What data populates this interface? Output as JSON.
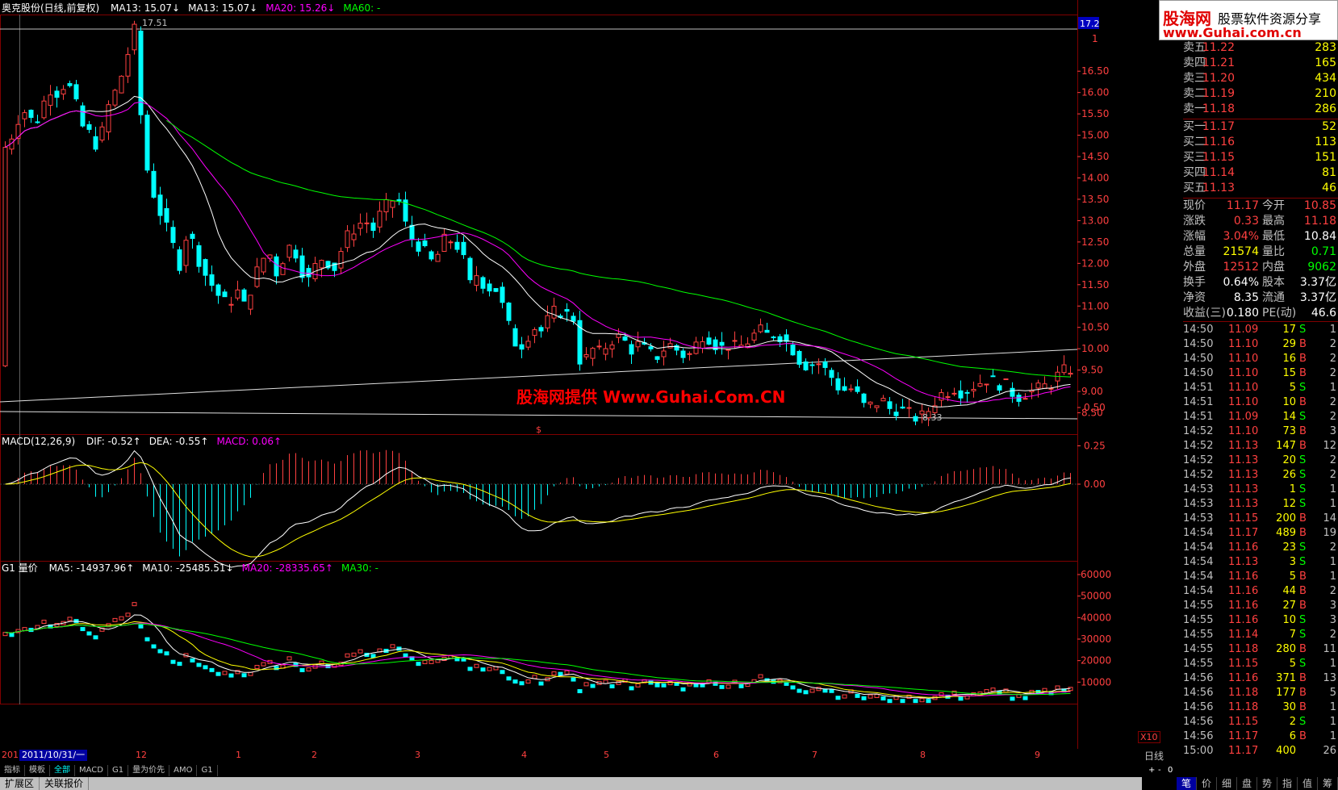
{
  "header": {
    "main": {
      "title": "奥克股份(日线,前复权)",
      "ma_items": [
        {
          "label": "MA13: 15.07",
          "arrow": "↓",
          "color": "#ffffff"
        },
        {
          "label": "MA13: 15.07",
          "arrow": "↓",
          "color": "#ffffff"
        },
        {
          "label": "MA20: 15.26",
          "arrow": "↓",
          "color": "#ff00ff"
        },
        {
          "label": "MA60: -",
          "arrow": "",
          "color": "#00ff00"
        }
      ]
    },
    "macd": {
      "title": "MACD(12,26,9)",
      "items": [
        {
          "label": "DIF: -0.52",
          "arrow": "↑",
          "color": "#ffffff"
        },
        {
          "label": "DEA: -0.55",
          "arrow": "↑",
          "color": "#ffffff"
        },
        {
          "label": "MACD: 0.06",
          "arrow": "↑",
          "color": "#ff00ff"
        }
      ]
    },
    "vol": {
      "title": "G1 量价",
      "items": [
        {
          "label": "MA5: -14937.96",
          "arrow": "↑",
          "color": "#ffffff"
        },
        {
          "label": "MA10: -25485.51",
          "arrow": "↓",
          "color": "#ffffff"
        },
        {
          "label": "MA20: -28335.65",
          "arrow": "↑",
          "color": "#ff00ff"
        },
        {
          "label": "MA30: -",
          "arrow": "",
          "color": "#00ff00"
        }
      ]
    }
  },
  "price_axis": {
    "current_tag": "17.2",
    "ticks": [
      "16.50",
      "16.00",
      "15.50",
      "15.00",
      "14.50",
      "14.00",
      "13.50",
      "13.00",
      "12.50",
      "12.00",
      "11.50",
      "11.00",
      "10.50",
      "10.00",
      "9.50",
      "9.00",
      "8.50"
    ],
    "top_label": "1"
  },
  "macd_axis": {
    "ticks": [
      "0.50",
      "0.25",
      "0.00"
    ]
  },
  "vol_axis": {
    "ticks": [
      "60000",
      "50000",
      "40000",
      "30000",
      "20000",
      "10000"
    ],
    "scale_label": "X10"
  },
  "annotations": {
    "high_label": "17.51",
    "low_label": "8.33",
    "marker": "$",
    "watermark": "股海网提供 Www.Guhai.Com.CN"
  },
  "x_axis": {
    "date_box": "2011/10/31/一",
    "left_stub": "201",
    "labels": [
      "12",
      "1",
      "2",
      "3",
      "4",
      "5",
      "6",
      "7",
      "8",
      "9"
    ],
    "period": "日线"
  },
  "banner": {
    "site": "股海网",
    "slogan": "股票软件资源分享",
    "url": "www.Guhai.com.cn"
  },
  "orderbook": {
    "asks": [
      {
        "label": "卖五",
        "price": "11.22",
        "vol": "283"
      },
      {
        "label": "卖四",
        "price": "11.21",
        "vol": "165"
      },
      {
        "label": "卖三",
        "price": "11.20",
        "vol": "434"
      },
      {
        "label": "卖二",
        "price": "11.19",
        "vol": "210"
      },
      {
        "label": "卖一",
        "price": "11.18",
        "vol": "286"
      }
    ],
    "bids": [
      {
        "label": "买一",
        "price": "11.17",
        "vol": "52"
      },
      {
        "label": "买二",
        "price": "11.16",
        "vol": "113"
      },
      {
        "label": "买三",
        "price": "11.15",
        "vol": "151"
      },
      {
        "label": "买四",
        "price": "11.14",
        "vol": "81"
      },
      {
        "label": "买五",
        "price": "11.13",
        "vol": "46"
      }
    ]
  },
  "quote": [
    {
      "l1": "现价",
      "v1": "11.17",
      "c1": "#ff4040",
      "l2": "今开",
      "v2": "10.85",
      "c2": "#ff4040"
    },
    {
      "l1": "涨跌",
      "v1": "0.33",
      "c1": "#ff4040",
      "l2": "最高",
      "v2": "11.18",
      "c2": "#ff4040"
    },
    {
      "l1": "涨幅",
      "v1": "3.04%",
      "c1": "#ff4040",
      "l2": "最低",
      "v2": "10.84",
      "c2": "#ffffff"
    },
    {
      "l1": "总量",
      "v1": "21574",
      "c1": "#ffff00",
      "l2": "量比",
      "v2": "0.71",
      "c2": "#00ff00"
    },
    {
      "l1": "外盘",
      "v1": "12512",
      "c1": "#ff4040",
      "l2": "内盘",
      "v2": "9062",
      "c2": "#00ff00"
    },
    {
      "l1": "换手",
      "v1": "0.64%",
      "c1": "#ffffff",
      "l2": "股本",
      "v2": "3.37亿",
      "c2": "#ffffff"
    },
    {
      "l1": "净资",
      "v1": "8.35",
      "c1": "#ffffff",
      "l2": "流通",
      "v2": "3.37亿",
      "c2": "#ffffff"
    },
    {
      "l1": "收益(三)",
      "v1": "0.180",
      "c1": "#ffffff",
      "l2": "PE(动)",
      "v2": "46.6",
      "c2": "#ffffff"
    }
  ],
  "ticks": [
    {
      "time": "14:50",
      "price": "11.09",
      "vol": "17",
      "dir": "S",
      "n": "1"
    },
    {
      "time": "14:50",
      "price": "11.10",
      "vol": "29",
      "dir": "B",
      "n": "2"
    },
    {
      "time": "14:50",
      "price": "11.10",
      "vol": "16",
      "dir": "B",
      "n": "2"
    },
    {
      "time": "14:50",
      "price": "11.10",
      "vol": "15",
      "dir": "B",
      "n": "2"
    },
    {
      "time": "14:51",
      "price": "11.10",
      "vol": "5",
      "dir": "S",
      "n": "1"
    },
    {
      "time": "14:51",
      "price": "11.10",
      "vol": "10",
      "dir": "B",
      "n": "2"
    },
    {
      "time": "14:51",
      "price": "11.09",
      "vol": "14",
      "dir": "S",
      "n": "2"
    },
    {
      "time": "14:52",
      "price": "11.10",
      "vol": "73",
      "dir": "B",
      "n": "3"
    },
    {
      "time": "14:52",
      "price": "11.13",
      "vol": "147",
      "dir": "B",
      "n": "12"
    },
    {
      "time": "14:52",
      "price": "11.13",
      "vol": "20",
      "dir": "S",
      "n": "2"
    },
    {
      "time": "14:52",
      "price": "11.13",
      "vol": "26",
      "dir": "S",
      "n": "2"
    },
    {
      "time": "14:53",
      "price": "11.13",
      "vol": "1",
      "dir": "S",
      "n": "1"
    },
    {
      "time": "14:53",
      "price": "11.13",
      "vol": "12",
      "dir": "S",
      "n": "1"
    },
    {
      "time": "14:53",
      "price": "11.15",
      "vol": "200",
      "dir": "B",
      "n": "14"
    },
    {
      "time": "14:54",
      "price": "11.17",
      "vol": "489",
      "dir": "B",
      "n": "19"
    },
    {
      "time": "14:54",
      "price": "11.16",
      "vol": "23",
      "dir": "S",
      "n": "2"
    },
    {
      "time": "14:54",
      "price": "11.13",
      "vol": "3",
      "dir": "S",
      "n": "1"
    },
    {
      "time": "14:54",
      "price": "11.16",
      "vol": "5",
      "dir": "B",
      "n": "1"
    },
    {
      "time": "14:54",
      "price": "11.16",
      "vol": "44",
      "dir": "B",
      "n": "2"
    },
    {
      "time": "14:55",
      "price": "11.16",
      "vol": "27",
      "dir": "B",
      "n": "3"
    },
    {
      "time": "14:55",
      "price": "11.16",
      "vol": "10",
      "dir": "S",
      "n": "3"
    },
    {
      "time": "14:55",
      "price": "11.14",
      "vol": "7",
      "dir": "S",
      "n": "2"
    },
    {
      "time": "14:55",
      "price": "11.18",
      "vol": "280",
      "dir": "B",
      "n": "11"
    },
    {
      "time": "14:55",
      "price": "11.15",
      "vol": "5",
      "dir": "S",
      "n": "1"
    },
    {
      "time": "14:56",
      "price": "11.16",
      "vol": "371",
      "dir": "B",
      "n": "13"
    },
    {
      "time": "14:56",
      "price": "11.18",
      "vol": "177",
      "dir": "B",
      "n": "5"
    },
    {
      "time": "14:56",
      "price": "11.18",
      "vol": "30",
      "dir": "B",
      "n": "1"
    },
    {
      "time": "14:56",
      "price": "11.15",
      "vol": "2",
      "dir": "S",
      "n": "1"
    },
    {
      "time": "14:56",
      "price": "11.17",
      "vol": "6",
      "dir": "B",
      "n": "1"
    },
    {
      "time": "15:00",
      "price": "11.17",
      "vol": "400",
      "dir": "",
      "n": "26"
    }
  ],
  "toolbar": {
    "items": [
      "指标",
      "模板",
      "全部",
      "MACD",
      "G1",
      "量为价先",
      "AMO",
      "G1"
    ],
    "active_index": 2
  },
  "status": {
    "items": [
      "扩展区",
      "关联报价"
    ]
  },
  "right_tabs": {
    "items": [
      "笔",
      "价",
      "细",
      "盘",
      "势",
      "指",
      "值",
      "筹"
    ],
    "active_index": 0
  },
  "controls": {
    "plus": "+",
    "minus": "-",
    "zero": "0"
  },
  "colors": {
    "up": "#ff4040",
    "down": "#00ffff",
    "ma_white": "#ffffff",
    "ma_magenta": "#ff00ff",
    "ma_green": "#00ff00",
    "border": "#800000",
    "text": "#c0c0c0"
  },
  "chart_data": {
    "type": "candlestick",
    "price_range": [
      8.0,
      17.6
    ],
    "high": 17.51,
    "low": 8.33,
    "price_path": [
      [
        0,
        14.6
      ],
      [
        10,
        14.9
      ],
      [
        20,
        15.4
      ],
      [
        30,
        15.6
      ],
      [
        40,
        15.2
      ],
      [
        50,
        15.7
      ],
      [
        60,
        16.1
      ],
      [
        70,
        16.0
      ],
      [
        80,
        16.3
      ],
      [
        90,
        15.8
      ],
      [
        100,
        15.2
      ],
      [
        110,
        15.0
      ],
      [
        120,
        14.7
      ],
      [
        130,
        15.6
      ],
      [
        140,
        16.0
      ],
      [
        150,
        16.5
      ],
      [
        160,
        17.2
      ],
      [
        165,
        17.5
      ],
      [
        170,
        15.8
      ],
      [
        180,
        14.2
      ],
      [
        190,
        13.5
      ],
      [
        200,
        13.0
      ],
      [
        210,
        12.5
      ],
      [
        220,
        12.0
      ],
      [
        230,
        12.8
      ],
      [
        240,
        12.3
      ],
      [
        250,
        11.8
      ],
      [
        260,
        11.5
      ],
      [
        270,
        11.2
      ],
      [
        280,
        11.0
      ],
      [
        290,
        11.4
      ],
      [
        300,
        11.0
      ],
      [
        310,
        11.5
      ],
      [
        320,
        12.0
      ],
      [
        330,
        12.3
      ],
      [
        340,
        11.8
      ],
      [
        350,
        12.2
      ],
      [
        360,
        12.5
      ],
      [
        370,
        11.9
      ],
      [
        380,
        11.6
      ],
      [
        390,
        12.0
      ],
      [
        400,
        12.2
      ],
      [
        410,
        11.8
      ],
      [
        420,
        12.3
      ],
      [
        430,
        12.7
      ],
      [
        440,
        12.9
      ],
      [
        450,
        13.0
      ],
      [
        460,
        12.8
      ],
      [
        470,
        13.2
      ],
      [
        480,
        13.4
      ],
      [
        490,
        13.6
      ],
      [
        495,
        13.2
      ],
      [
        500,
        12.9
      ],
      [
        510,
        12.5
      ],
      [
        520,
        12.4
      ],
      [
        530,
        12.0
      ],
      [
        540,
        12.2
      ],
      [
        550,
        12.6
      ],
      [
        560,
        12.5
      ],
      [
        570,
        12.3
      ],
      [
        575,
        11.7
      ],
      [
        580,
        11.5
      ],
      [
        590,
        11.8
      ],
      [
        600,
        11.4
      ],
      [
        610,
        11.5
      ],
      [
        620,
        11.0
      ],
      [
        630,
        10.4
      ],
      [
        640,
        10.0
      ],
      [
        650,
        10.3
      ],
      [
        660,
        10.5
      ],
      [
        670,
        10.4
      ],
      [
        680,
        10.8
      ],
      [
        690,
        10.9
      ],
      [
        700,
        10.8
      ],
      [
        710,
        10.7
      ],
      [
        715,
        9.8
      ],
      [
        720,
        9.6
      ],
      [
        730,
        10.0
      ],
      [
        740,
        9.9
      ],
      [
        750,
        10.1
      ],
      [
        760,
        10.3
      ],
      [
        770,
        10.2
      ],
      [
        780,
        10.0
      ],
      [
        790,
        10.1
      ],
      [
        800,
        9.9
      ],
      [
        810,
        9.8
      ],
      [
        820,
        10.0
      ],
      [
        830,
        10.1
      ],
      [
        840,
        9.9
      ],
      [
        850,
        9.8
      ],
      [
        860,
        10.1
      ],
      [
        870,
        10.4
      ],
      [
        880,
        10.2
      ],
      [
        890,
        10.0
      ],
      [
        900,
        10.1
      ],
      [
        910,
        10.0
      ],
      [
        920,
        10.1
      ],
      [
        930,
        10.3
      ],
      [
        940,
        10.4
      ],
      [
        950,
        10.3
      ],
      [
        960,
        10.4
      ],
      [
        970,
        10.2
      ],
      [
        980,
        10.0
      ],
      [
        990,
        9.7
      ],
      [
        1000,
        9.6
      ],
      [
        1010,
        9.7
      ],
      [
        1020,
        9.5
      ],
      [
        1030,
        9.3
      ],
      [
        1040,
        9.0
      ],
      [
        1050,
        9.1
      ],
      [
        1060,
        8.9
      ],
      [
        1070,
        8.6
      ],
      [
        1080,
        8.7
      ],
      [
        1090,
        8.8
      ],
      [
        1100,
        8.6
      ],
      [
        1110,
        8.6
      ],
      [
        1120,
        8.5
      ],
      [
        1130,
        8.4
      ],
      [
        1140,
        8.4
      ],
      [
        1150,
        8.6
      ],
      [
        1160,
        8.9
      ],
      [
        1170,
        9.0
      ],
      [
        1180,
        9.1
      ],
      [
        1190,
        9.0
      ],
      [
        1200,
        9.1
      ],
      [
        1210,
        9.2
      ],
      [
        1220,
        9.3
      ],
      [
        1230,
        9.2
      ],
      [
        1240,
        9.2
      ],
      [
        1250,
        9.0
      ],
      [
        1260,
        8.9
      ],
      [
        1270,
        9.0
      ],
      [
        1280,
        9.0
      ],
      [
        1290,
        9.1
      ],
      [
        1300,
        9.2
      ],
      [
        1310,
        9.4
      ],
      [
        1320,
        9.5
      ],
      [
        1330,
        9.6
      ]
    ]
  }
}
